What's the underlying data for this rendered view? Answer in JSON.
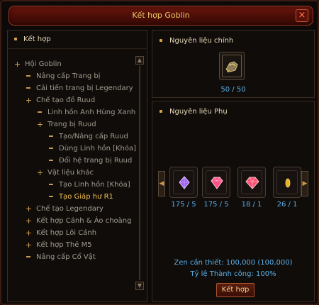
{
  "window": {
    "title": "Kết hợp Goblin",
    "close_glyph": "×"
  },
  "left": {
    "header": "Kết hợp",
    "tree": [
      {
        "label": "Hội Goblin",
        "marker": "plus",
        "active": false
      },
      {
        "label": "Nâng cấp Trang bị",
        "marker": "bar",
        "active": false
      },
      {
        "label": "Cải tiến trang bị Legendary",
        "marker": "bar",
        "active": false
      },
      {
        "label": "Chế tạo đồ Ruud",
        "marker": "plus",
        "active": false
      },
      {
        "label": "Linh hồn Anh Hùng Xanh",
        "marker": "bar",
        "active": false
      },
      {
        "label": "Trang bị Ruud",
        "marker": "plus",
        "active": false
      },
      {
        "label": "Tạo/Nâng cấp Ruud",
        "marker": "bar",
        "active": false
      },
      {
        "label": "Dùng Linh hồn [Khóa]",
        "marker": "bar",
        "active": false
      },
      {
        "label": "Đổi hệ trang bị Ruud",
        "marker": "bar",
        "active": false
      },
      {
        "label": "Vật liệu khác",
        "marker": "plus",
        "active": false
      },
      {
        "label": "Tạo Linh hồn [Khóa]",
        "marker": "bar",
        "active": false
      },
      {
        "label": "Tạo Giáp hư R1",
        "marker": "bar",
        "active": true
      },
      {
        "label": "Chế tạo Legendary",
        "marker": "plus",
        "active": false
      },
      {
        "label": "Kết hợp Cánh & Áo choàng",
        "marker": "plus",
        "active": false
      },
      {
        "label": "Kết hợp Lõi Cánh",
        "marker": "plus",
        "active": false
      },
      {
        "label": "Kết hợp Thẻ M5",
        "marker": "plus",
        "active": false
      },
      {
        "label": "Nâng cấp Cổ Vật",
        "marker": "bar",
        "active": false
      }
    ]
  },
  "main": {
    "header": "Nguyên liệu chính",
    "item_icon": "armor-fragment-icon",
    "count": "50 / 50"
  },
  "sub": {
    "header": "Nguyên liệu Phụ",
    "items": [
      {
        "icon": "purple-gem-icon",
        "color": "#b070ff",
        "count": "175 / 5"
      },
      {
        "icon": "pink-gem-icon",
        "color": "#ff4f86",
        "count": "175 / 5"
      },
      {
        "icon": "red-gem-icon",
        "color": "#ff4f70",
        "count": "18 / 1"
      },
      {
        "icon": "gold-shard-icon",
        "color": "#e8b020",
        "count": "26 / 1"
      }
    ],
    "zen_text": "Zen cần thiết: 100,000 (100,000)",
    "rate_text": "Tỷ lệ Thành công: 100%",
    "combine_label": "Kết hợp"
  }
}
